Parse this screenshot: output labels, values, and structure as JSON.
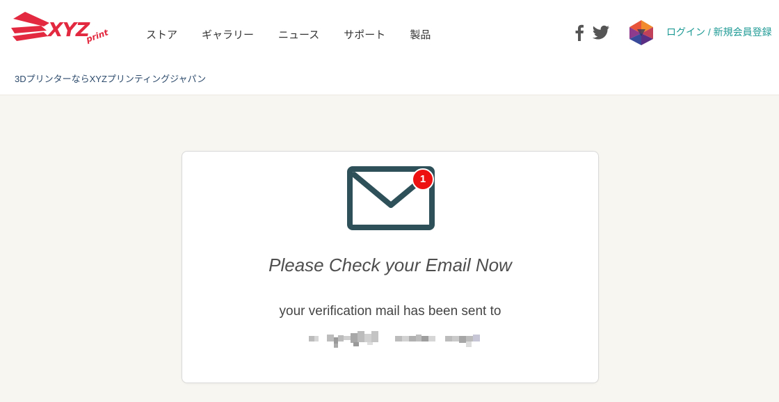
{
  "header": {
    "logo_text": "XYZprinting",
    "nav": [
      "ストア",
      "ギャラリー",
      "ニュース",
      "サポート",
      "製品"
    ],
    "social": {
      "facebook_icon": "facebook-icon",
      "twitter_icon": "twitter-icon"
    },
    "avatar_icon": "polyhedron-avatar-icon",
    "login_label": "ログイン / 新規会員登録",
    "tagline": "3DプリンターならXYZプリンティングジャパン"
  },
  "colors": {
    "page_bg": "#f8f6f0",
    "logo_red": "#e2293f",
    "accent_teal": "#1e9a95",
    "mail_icon": "#2e5058",
    "badge_red": "#ee1111"
  },
  "card": {
    "icon": "envelope-icon",
    "badge_count": "1",
    "title": "Please Check your Email Now",
    "message": "your verification mail has been sent to",
    "email_obscured": true
  }
}
